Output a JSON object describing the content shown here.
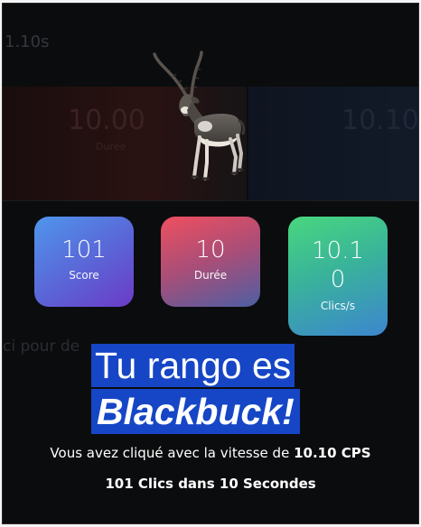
{
  "background": {
    "timer_label": "1.10s",
    "left_number": "10.00",
    "left_sub": "Durée",
    "right_number": "10.10",
    "click_prompt": "ci pour de"
  },
  "result_animal": {
    "name": "Blackbuck",
    "icon": "blackbuck-antelope-icon"
  },
  "stats": {
    "score": {
      "value": "101",
      "label": "Score"
    },
    "duration": {
      "value": "10",
      "label": "Durée"
    },
    "cps": {
      "value": "10.10",
      "label": "Clics/s"
    }
  },
  "headline": {
    "line1": "Tu rango es",
    "line2": "Blackbuck!"
  },
  "summary": {
    "speed_prefix": "Vous avez cliqué avec la vitesse de",
    "speed_value": "10.10 CPS",
    "clicks_line": "101 Clics dans 10 Secondes"
  },
  "colors": {
    "highlight": "#1646c6",
    "background": "#0b0c0e"
  }
}
